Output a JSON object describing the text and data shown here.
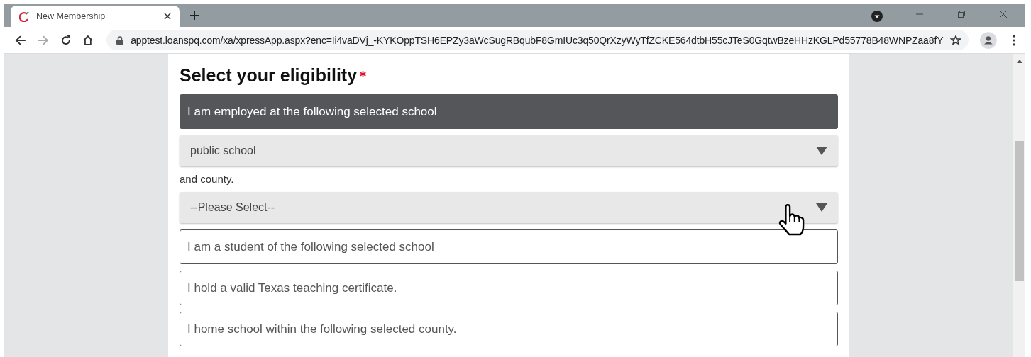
{
  "browser": {
    "tab": {
      "title": "New Membership",
      "selected": true
    },
    "url": "apptest.loanspq.com/xa/xpressApp.aspx?enc=Ii4vaDVj_-KYKOppTSH6EPZy3aWcSugRBqubF8GmIUc3q50QrXzyWyTfZCKE564dtbH55cJTeS0GqtwBzeHHzKGLPd55778B48WNPZaa8fY"
  },
  "form": {
    "title": "Select your eligibility",
    "required": true,
    "options": [
      {
        "label": "I am employed at the following selected school",
        "selected": true,
        "fields": [
          {
            "kind": "select",
            "value": "public school"
          },
          {
            "kind": "text",
            "value": "and county."
          },
          {
            "kind": "select",
            "value": "--Please Select--"
          }
        ]
      },
      {
        "label": "I am a student of the following selected school",
        "selected": false
      },
      {
        "label": "I hold a valid Texas teaching certificate.",
        "selected": false
      },
      {
        "label": "I home school within the following selected county.",
        "selected": false
      }
    ]
  }
}
